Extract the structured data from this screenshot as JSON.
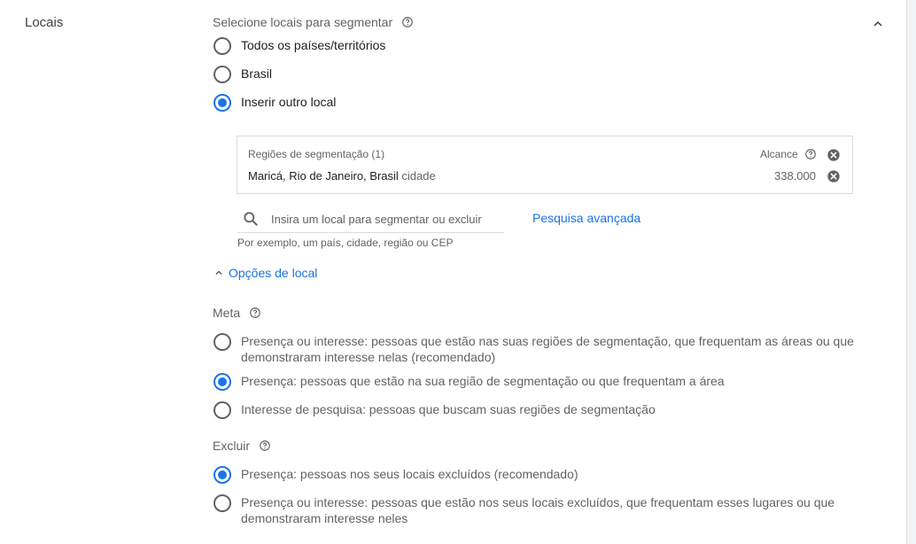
{
  "section": {
    "label": "Locais"
  },
  "target": {
    "heading": "Selecione locais para segmentar",
    "options": [
      {
        "label": "Todos os países/territórios",
        "checked": false
      },
      {
        "label": "Brasil",
        "checked": false
      },
      {
        "label": "Inserir outro local",
        "checked": true
      }
    ]
  },
  "regions": {
    "title": "Regiões de segmentação (1)",
    "reach_label": "Alcance",
    "items": [
      {
        "name": "Maricá, Rio de Janeiro, Brasil",
        "type": "cidade",
        "reach": "338.000"
      }
    ]
  },
  "search": {
    "placeholder": "Insira um local para segmentar ou excluir",
    "value": "",
    "hint": "Por exemplo, um país, cidade, região ou CEP",
    "advanced_link": "Pesquisa avançada"
  },
  "location_options": {
    "label": "Opções de local",
    "expanded": true
  },
  "goal": {
    "heading": "Meta",
    "options": [
      {
        "line1": "Presença ou interesse: pessoas que estão nas suas regiões de segmentação, que frequentam as áreas ou que",
        "line2": "demonstraram interesse nelas (recomendado)",
        "checked": false
      },
      {
        "line1": "Presença: pessoas que estão na sua região de segmentação ou que frequentam a área",
        "checked": true
      },
      {
        "line1": "Interesse de pesquisa: pessoas que buscam suas regiões de segmentação",
        "checked": false
      }
    ]
  },
  "exclude": {
    "heading": "Excluir",
    "options": [
      {
        "line1": "Presença: pessoas nos seus locais excluídos (recomendado)",
        "checked": true
      },
      {
        "line1": "Presença ou interesse: pessoas que estão nos seus locais excluídos, que frequentam esses lugares ou que",
        "line2": "demonstraram interesse neles",
        "checked": false
      }
    ]
  },
  "colors": {
    "accent": "#1a73e8",
    "text": "#202124",
    "muted": "#5f6368",
    "border": "#dadce0"
  },
  "icons": [
    "help-icon",
    "chevron-up-icon",
    "close-circle-icon",
    "search-icon"
  ]
}
